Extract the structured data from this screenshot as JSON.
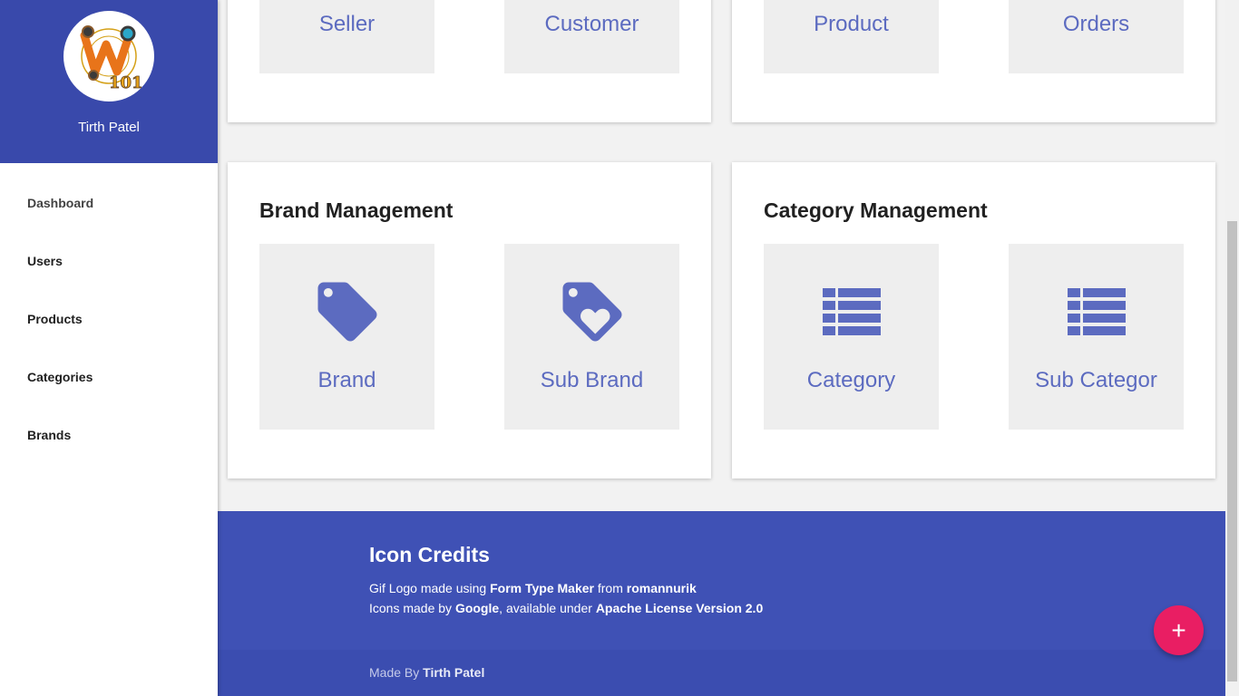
{
  "sidebar": {
    "user_name": "Tirth Patel",
    "logo_alt": "W101 logo",
    "items": [
      {
        "label": "Dashboard"
      },
      {
        "label": "Users"
      },
      {
        "label": "Products"
      },
      {
        "label": "Categories"
      },
      {
        "label": "Brands"
      }
    ]
  },
  "top_cards": {
    "left": {
      "tiles": [
        {
          "label": "Seller"
        },
        {
          "label": "Customer"
        }
      ]
    },
    "right": {
      "tiles": [
        {
          "label": "Product"
        },
        {
          "label": "Orders"
        }
      ]
    }
  },
  "brand_card": {
    "title": "Brand Management",
    "tiles": [
      {
        "label": "Brand",
        "icon": "tag-icon"
      },
      {
        "label": "Sub Brand",
        "icon": "tag-heart-icon"
      }
    ]
  },
  "category_card": {
    "title": "Category Management",
    "tiles": [
      {
        "label": "Category",
        "icon": "list-icon"
      },
      {
        "label": "Sub Categor",
        "icon": "list-icon"
      }
    ]
  },
  "footer": {
    "credits_title": "Icon Credits",
    "line1": {
      "prefix": "Gif Logo made using ",
      "link1": "Form Type Maker",
      "middle": " from ",
      "link2": "romannurik"
    },
    "line2": {
      "prefix": "Icons made by ",
      "link1": "Google",
      "middle": ", available under ",
      "link2": "Apache License Version 2.0"
    },
    "made_by_prefix": "Made By ",
    "made_by_name": "Tirth Patel"
  },
  "fab": {
    "symbol": "+"
  },
  "colors": {
    "primary": "#3949ab",
    "footer": "#3f51b5",
    "accent": "#e91e63",
    "tile_text": "#5c6bc0",
    "tile_bg": "#eeeeee"
  }
}
